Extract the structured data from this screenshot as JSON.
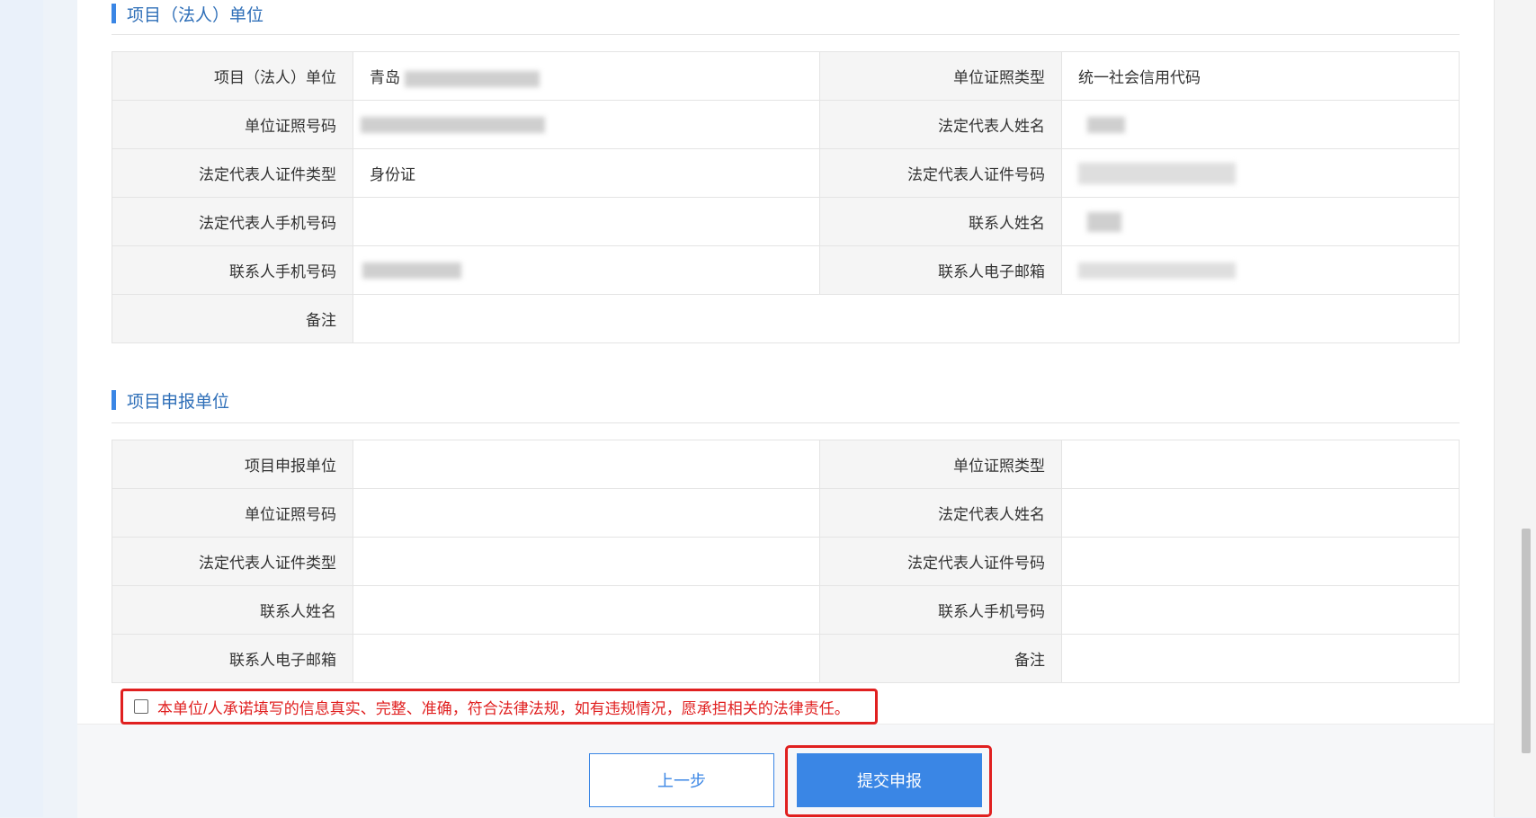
{
  "sections": {
    "legal_unit": {
      "title": "项目（法人）单位",
      "rows": [
        {
          "label1": "项目（法人）单位",
          "value1": "青岛",
          "label2": "单位证照类型",
          "value2": "统一社会信用代码"
        },
        {
          "label1": "单位证照号码",
          "value1": "",
          "label2": "法定代表人姓名",
          "value2": ""
        },
        {
          "label1": "法定代表人证件类型",
          "value1": "身份证",
          "label2": "法定代表人证件号码",
          "value2": ""
        },
        {
          "label1": "法定代表人手机号码",
          "value1": "",
          "label2": "联系人姓名",
          "value2": ""
        },
        {
          "label1": "联系人手机号码",
          "value1": "",
          "label2": "联系人电子邮箱",
          "value2": ""
        },
        {
          "label1": "备注",
          "value1": ""
        }
      ]
    },
    "declaring_unit": {
      "title": "项目申报单位",
      "rows": [
        {
          "label1": "项目申报单位",
          "value1": "",
          "label2": "单位证照类型",
          "value2": ""
        },
        {
          "label1": "单位证照号码",
          "value1": "",
          "label2": "法定代表人姓名",
          "value2": ""
        },
        {
          "label1": "法定代表人证件类型",
          "value1": "",
          "label2": "法定代表人证件号码",
          "value2": ""
        },
        {
          "label1": "联系人姓名",
          "value1": "",
          "label2": "联系人手机号码",
          "value2": ""
        },
        {
          "label1": "联系人电子邮箱",
          "value1": "",
          "label2": "备注",
          "value2": ""
        }
      ]
    }
  },
  "declaration": {
    "text": "本单位/人承诺填写的信息真实、完整、准确，符合法律法规，如有违规情况，愿承担相关的法律责任。",
    "checked": false
  },
  "buttons": {
    "prev_label": "上一步",
    "submit_label": "提交申报"
  },
  "colors": {
    "accent": "#3a86e5",
    "highlight_red": "#e02020"
  }
}
